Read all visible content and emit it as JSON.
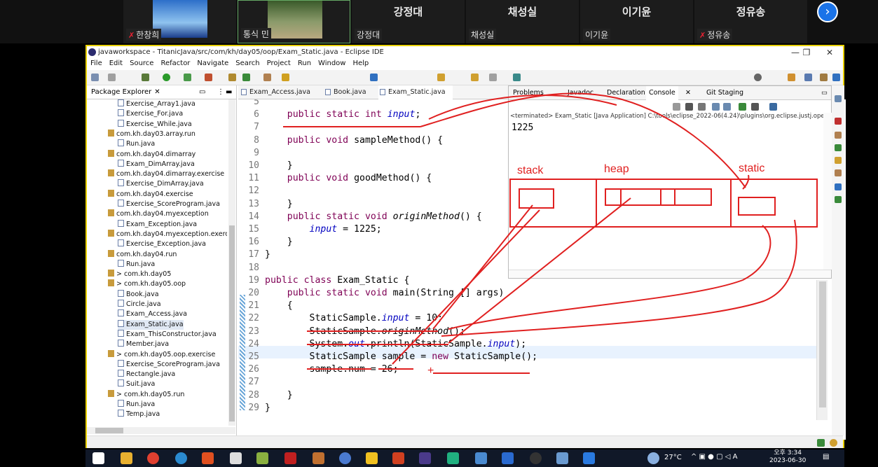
{
  "participants": [
    {
      "name": "한창희",
      "big": "",
      "muted": true
    },
    {
      "name": "통식 민",
      "big": "",
      "muted": false
    },
    {
      "name": "강정대",
      "big": "강정대",
      "muted": false
    },
    {
      "name": "채성실",
      "big": "채성실",
      "muted": false
    },
    {
      "name": "이기윤",
      "big": "이기윤",
      "muted": false
    },
    {
      "name": "정유송",
      "big": "정유송",
      "muted": true
    }
  ],
  "window": {
    "title": "javaworkspace - TitanicJava/src/com/kh/day05/oop/Exam_Static.java - Eclipse IDE"
  },
  "menu": [
    "File",
    "Edit",
    "Source",
    "Refactor",
    "Navigate",
    "Search",
    "Project",
    "Run",
    "Window",
    "Help"
  ],
  "package_explorer": {
    "title": "Package Explorer",
    "items": [
      {
        "label": "Exercise_Array1.java",
        "kind": "file"
      },
      {
        "label": "Exercise_For.java",
        "kind": "file"
      },
      {
        "label": "Exercise_While.java",
        "kind": "file"
      },
      {
        "label": "com.kh.day03.array.run",
        "kind": "pkg"
      },
      {
        "label": "Run.java",
        "kind": "file"
      },
      {
        "label": "com.kh.day04.dimarray",
        "kind": "pkg"
      },
      {
        "label": "Exam_DimArray.java",
        "kind": "file"
      },
      {
        "label": "com.kh.day04.dimarray.exercise",
        "kind": "pkg"
      },
      {
        "label": "Exercise_DimArray.java",
        "kind": "file"
      },
      {
        "label": "com.kh.day04.exercise",
        "kind": "pkg"
      },
      {
        "label": "Exercise_ScoreProgram.java",
        "kind": "file"
      },
      {
        "label": "com.kh.day04.myexception",
        "kind": "pkg"
      },
      {
        "label": "Exam_Exception.java",
        "kind": "file"
      },
      {
        "label": "com.kh.day04.myexception.exerc",
        "kind": "pkg"
      },
      {
        "label": "Exercise_Exception.java",
        "kind": "file"
      },
      {
        "label": "com.kh.day04.run",
        "kind": "pkg"
      },
      {
        "label": "Run.java",
        "kind": "file"
      },
      {
        "label": "> com.kh.day05",
        "kind": "pkg"
      },
      {
        "label": "> com.kh.day05.oop",
        "kind": "pkg"
      },
      {
        "label": "Book.java",
        "kind": "file"
      },
      {
        "label": "Circle.java",
        "kind": "file"
      },
      {
        "label": "Exam_Access.java",
        "kind": "file"
      },
      {
        "label": "Exam_Static.java",
        "kind": "file"
      },
      {
        "label": "Exam_ThisConstructor.java",
        "kind": "file"
      },
      {
        "label": "Member.java",
        "kind": "file"
      },
      {
        "label": "> com.kh.day05.oop.exercise",
        "kind": "pkg"
      },
      {
        "label": "Exercise_ScoreProgram.java",
        "kind": "file"
      },
      {
        "label": "Rectangle.java",
        "kind": "file"
      },
      {
        "label": "Suit.java",
        "kind": "file"
      },
      {
        "label": "> com.kh.day05.run",
        "kind": "pkg"
      },
      {
        "label": "Run.java",
        "kind": "file"
      },
      {
        "label": "Temp.java",
        "kind": "file"
      }
    ]
  },
  "editor_tabs": [
    {
      "label": "Exam_Access.java",
      "active": false
    },
    {
      "label": "Book.java",
      "active": false
    },
    {
      "label": "Exam_Static.java",
      "active": true
    }
  ],
  "code_lines": [
    {
      "n": "5",
      "t": ""
    },
    {
      "n": "6",
      "t": "    public static int input;"
    },
    {
      "n": "7",
      "t": ""
    },
    {
      "n": "8",
      "t": "    public void sampleMethod() {"
    },
    {
      "n": "9",
      "t": ""
    },
    {
      "n": "10",
      "t": "    }"
    },
    {
      "n": "11",
      "t": "    public void goodMethod() {"
    },
    {
      "n": "12",
      "t": ""
    },
    {
      "n": "13",
      "t": "    }"
    },
    {
      "n": "14",
      "t": "    public static void originMethod() {"
    },
    {
      "n": "15",
      "t": "        input = 1225;"
    },
    {
      "n": "16",
      "t": "    }"
    },
    {
      "n": "17",
      "t": "}"
    },
    {
      "n": "18",
      "t": ""
    },
    {
      "n": "19",
      "t": "public class Exam_Static {"
    },
    {
      "n": "20",
      "t": "    public static void main(String [] args)"
    },
    {
      "n": "21",
      "t": "    {"
    },
    {
      "n": "22",
      "t": "        StaticSample.input = 10;"
    },
    {
      "n": "23",
      "t": "        StaticSample.originMethod();"
    },
    {
      "n": "24",
      "t": "        System.out.println(StaticSample.input);"
    },
    {
      "n": "25",
      "t": "        StaticSample sample = new StaticSample();"
    },
    {
      "n": "26",
      "t": "        sample.num = 26;"
    },
    {
      "n": "27",
      "t": ""
    },
    {
      "n": "28",
      "t": "    }"
    },
    {
      "n": "29",
      "t": "}"
    }
  ],
  "console": {
    "tabs": [
      "Problems",
      "Javadoc",
      "Declaration",
      "Console",
      "Git Staging"
    ],
    "terminated": "<terminated> Exam_Static [Java Application] C:\\tools\\eclipse_2022-06(4.24)\\plugins\\org.eclipse.justj.ope",
    "output": "1225"
  },
  "annotations": {
    "stack": "stack",
    "heap": "heap",
    "static": "static",
    "color": "#e02020"
  },
  "taskbar": {
    "temp": "27°C",
    "time": "오후 3:34",
    "date": "2023-06-30"
  }
}
